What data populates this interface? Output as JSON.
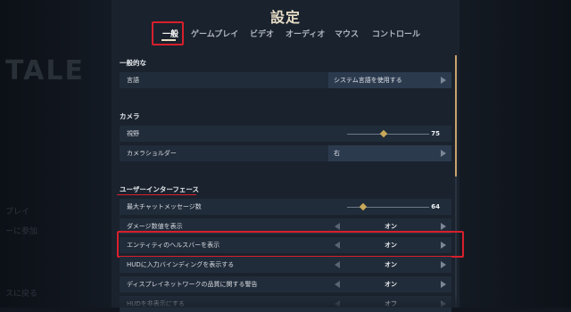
{
  "title": "設定",
  "tabs": [
    "一般",
    "ゲームプレイ",
    "ビデオ",
    "オーディオ",
    "マウス",
    "コントロール"
  ],
  "background": {
    "logo_text": "TALE",
    "menu_items": [
      "プレイ",
      "ーに参加",
      "スに戻る"
    ]
  },
  "sections": {
    "general": {
      "title": "一般的な",
      "language_label": "言語",
      "language_value": "システム言語を使用する"
    },
    "camera": {
      "title": "カメラ",
      "fov_label": "視野",
      "fov_value": "75",
      "fov_fraction": 0.45,
      "shoulder_label": "カメラショルダー",
      "shoulder_value": "右"
    },
    "ui": {
      "title": "ユーザーインターフェース",
      "chat_label": "最大チャットメッセージ数",
      "chat_value": "64",
      "chat_fraction": 0.2,
      "damage_label": "ダメージ数値を表示",
      "damage_value": "オン",
      "healthbar_label": "エンティティのヘルスバーを表示",
      "healthbar_value": "オン",
      "hud_binding_label": "HUDに入力バインディングを表示する",
      "hud_binding_value": "オン",
      "network_warning_label": "ディスプレイネットワークの品質に関する警告",
      "network_warning_value": "オン",
      "hide_hud_label": "HUDを非表示にする",
      "hide_hud_value": "オフ"
    }
  },
  "colors": {
    "highlight": "#d81f2c",
    "accent": "#c9a85a"
  }
}
